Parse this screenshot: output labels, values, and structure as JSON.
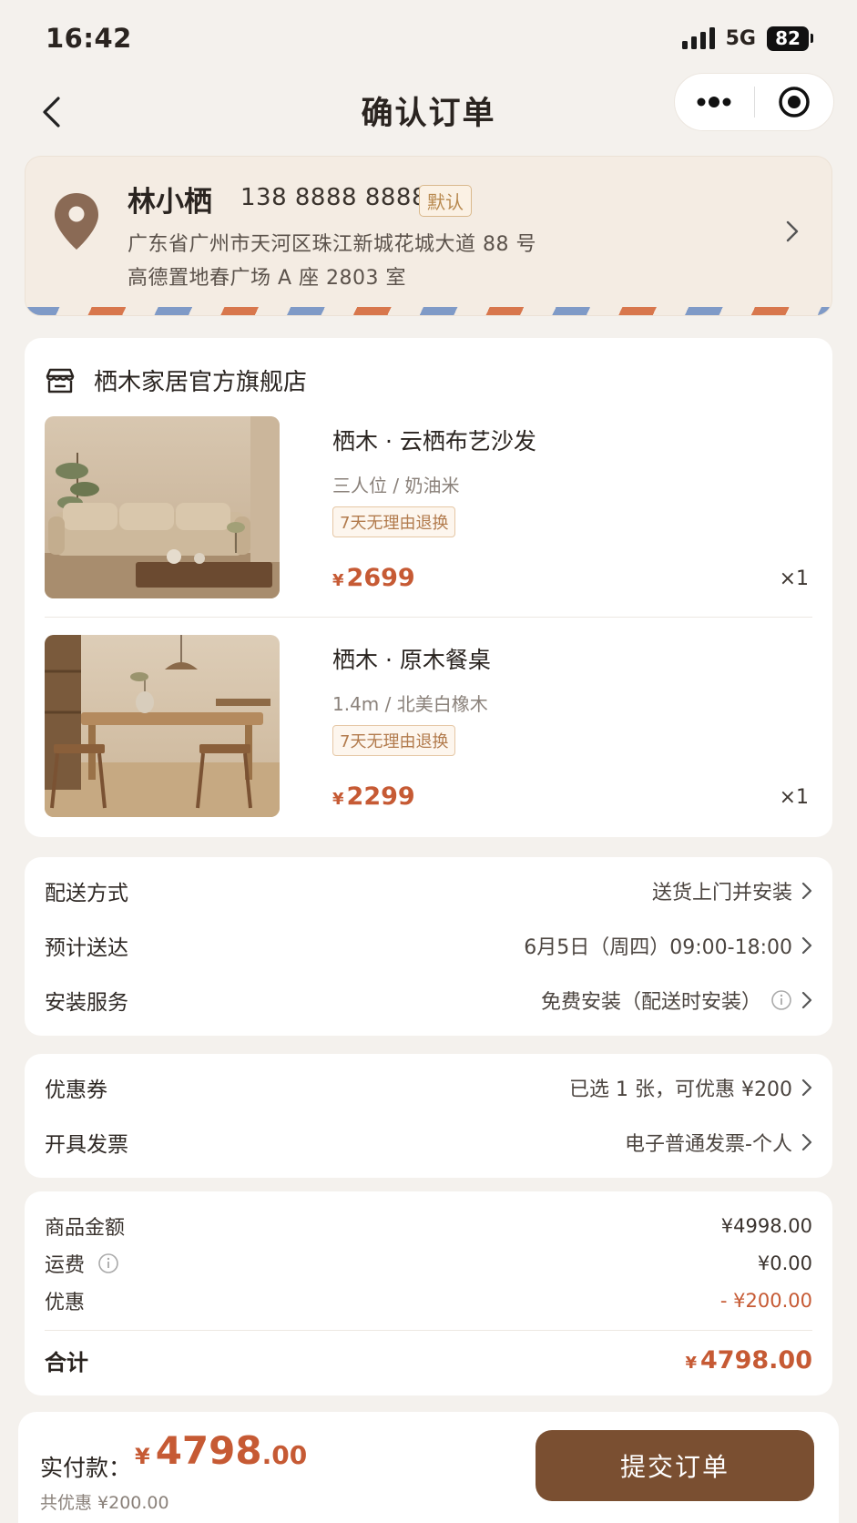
{
  "status_bar": {
    "time": "16:42",
    "network": "5G",
    "battery": "82"
  },
  "nav": {
    "title": "确认订单"
  },
  "address": {
    "name": "林小栖",
    "phone": "138 8888 8888",
    "tag": "默认",
    "line1": "广东省广州市天河区珠江新城花城大道 88 号",
    "line2": "高德置地春广场 A 座 2803 室"
  },
  "shop": {
    "name": "栖木家居官方旗舰店",
    "products": [
      {
        "name": "栖木 · 云栖布艺沙发",
        "spec": "三人位 / 奶油米",
        "tag": "7天无理由退换",
        "currency": "¥",
        "price": "2699",
        "qty": "×1"
      },
      {
        "name": "栖木 · 原木餐桌",
        "spec": "1.4m / 北美白橡木",
        "tag": "7天无理由退换",
        "currency": "¥",
        "price": "2299",
        "qty": "×1"
      }
    ]
  },
  "delivery": [
    {
      "label": "配送方式",
      "value": "送货上门并安装"
    },
    {
      "label": "预计送达",
      "value": "6月5日（周四）09:00-18:00"
    },
    {
      "label": "安装服务",
      "value": "免费安装（配送时安装）"
    }
  ],
  "coupon": [
    {
      "label": "优惠券",
      "value": "已选 1 张，可优惠 ¥200"
    },
    {
      "label": "开具发票",
      "value": "电子普通发票-个人"
    }
  ],
  "summary": {
    "goods_label": "商品金额",
    "goods_value": "¥4998.00",
    "shipping_label": "运费",
    "shipping_value": "¥0.00",
    "discount_label": "优惠",
    "discount_value": "- ¥200.00",
    "total_label": "合计",
    "total_currency": "¥",
    "total_value": "4798.00"
  },
  "bottom": {
    "pay_label": "实付款：",
    "pay_currency": "¥",
    "pay_int": "4798",
    "pay_dec": ".00",
    "saved": "共优惠 ¥200.00",
    "submit": "提交订单"
  },
  "colors": {
    "accent": "#c65a34",
    "button": "#7a4f31",
    "pin": "#8a6a55"
  }
}
